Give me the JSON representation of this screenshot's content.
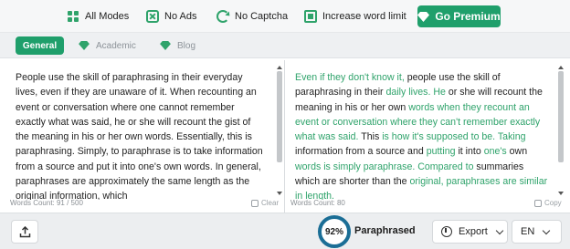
{
  "topbar": {
    "features": [
      {
        "label": "All Modes",
        "icon": "grid-icon"
      },
      {
        "label": "No Ads",
        "icon": "no-ads-icon"
      },
      {
        "label": "No Captcha",
        "icon": "refresh-icon"
      },
      {
        "label": "Increase word limit",
        "icon": "document-icon"
      }
    ],
    "premium_label": "Go Premium"
  },
  "modes": {
    "tabs": [
      {
        "label": "General",
        "active": true
      },
      {
        "label": "Academic",
        "icon": "diamond-icon"
      },
      {
        "label": "Blog",
        "icon": "diamond-icon"
      }
    ]
  },
  "input": {
    "text": "People use the skill of paraphrasing in their everyday lives, even if they are unaware of it. When recounting an event or conversation where one cannot remember exactly what was said, he or she will recount the gist of the meaning in his or her own words. Essentially, this is paraphrasing. Simply, to paraphrase is to take information from a source and put it into one's own words. In general, paraphrases are approximately the same length as the original information, which",
    "word_count": "Words Count: 91 / 500",
    "clear_label": "Clear"
  },
  "output": {
    "segments": [
      {
        "t": "Even if they don't know it,",
        "hl": true
      },
      {
        "t": " people use the skill of paraphrasing in their ",
        "hl": false
      },
      {
        "t": "daily lives. He",
        "hl": true
      },
      {
        "t": " or she will recount the meaning in his or her own ",
        "hl": false
      },
      {
        "t": "words when they recount an event or conversation where they can't remember exactly what was said.",
        "hl": true
      },
      {
        "t": " This ",
        "hl": false
      },
      {
        "t": "is how it's supposed to be. Taking",
        "hl": true
      },
      {
        "t": " information from a source and ",
        "hl": false
      },
      {
        "t": "putting",
        "hl": true
      },
      {
        "t": " it into ",
        "hl": false
      },
      {
        "t": "one's",
        "hl": true
      },
      {
        "t": " own ",
        "hl": false
      },
      {
        "t": "words is simply paraphrase. Compared to",
        "hl": true
      },
      {
        "t": " summaries which are shorter than the ",
        "hl": false
      },
      {
        "t": "original, paraphrases are similar in length.",
        "hl": true
      }
    ],
    "word_count": "Words Count: 80",
    "copy_label": "Copy"
  },
  "bottom": {
    "score": "92%",
    "score_value": 92,
    "score_label": "Paraphrased",
    "export_label": "Export",
    "language": "EN"
  },
  "colors": {
    "accent": "#1f9f6b",
    "highlight": "#2fa36b",
    "gauge": "#1b6e96"
  }
}
